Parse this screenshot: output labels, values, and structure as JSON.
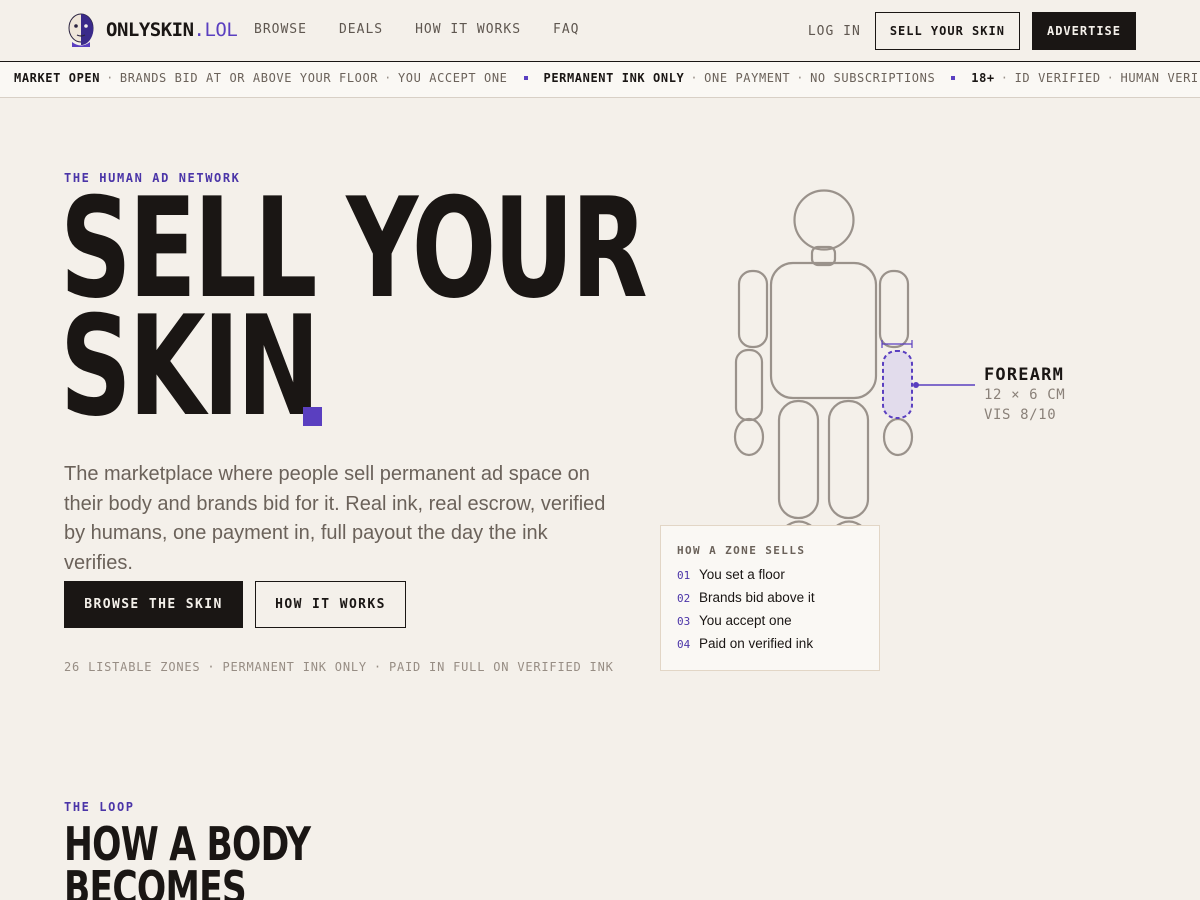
{
  "nav": {
    "brand_name": "ONLYSKIN",
    "brand_tld": ".LOL",
    "links": [
      "BROWSE",
      "DEALS",
      "HOW IT WORKS",
      "FAQ"
    ],
    "login": "LOG IN",
    "sell_button": "SELL YOUR SKIN",
    "advertise_button": "ADVERTISE"
  },
  "ticker": [
    {
      "lead": "MARKET OPEN",
      "items": [
        "BRANDS BID AT OR ABOVE YOUR FLOOR",
        "YOU ACCEPT ONE"
      ]
    },
    {
      "lead": "PERMANENT INK ONLY",
      "items": [
        "ONE PAYMENT",
        "NO SUBSCRIPTIONS"
      ]
    },
    {
      "lead": "18+",
      "items": [
        "ID VERIFIED",
        "HUMAN VERIFIED"
      ]
    }
  ],
  "hero": {
    "eyebrow": "THE HUMAN AD NETWORK",
    "title_line1": "SELL YOUR",
    "title_line2": "SKIN",
    "description": "The marketplace where people sell permanent ad space on their body and brands bid for it. Real ink, real escrow, verified by humans, one payment in, full payout the day the ink verifies.",
    "primary_button": "BROWSE THE SKIN",
    "secondary_button": "HOW IT WORKS",
    "meta": [
      "26 LISTABLE ZONES",
      "PERMANENT INK ONLY",
      "PAID IN FULL ON VERIFIED INK"
    ]
  },
  "zone": {
    "name": "FOREARM",
    "size": "12 × 6 CM",
    "visibility": "VIS 8/10"
  },
  "how_card": {
    "title": "HOW A ZONE SELLS",
    "steps": [
      {
        "num": "01",
        "text": "You set a floor"
      },
      {
        "num": "02",
        "text": "Brands bid above it"
      },
      {
        "num": "03",
        "text": "You accept one"
      },
      {
        "num": "04",
        "text": "Paid on verified ink"
      }
    ]
  },
  "loop": {
    "eyebrow": "THE LOOP",
    "title_line1": "HOW A BODY",
    "title_line2": "BECOMES"
  },
  "colors": {
    "background": "#f4f0ea",
    "ink": "#1a1614",
    "accent": "#5a3fc0",
    "muted": "#6b625a"
  }
}
